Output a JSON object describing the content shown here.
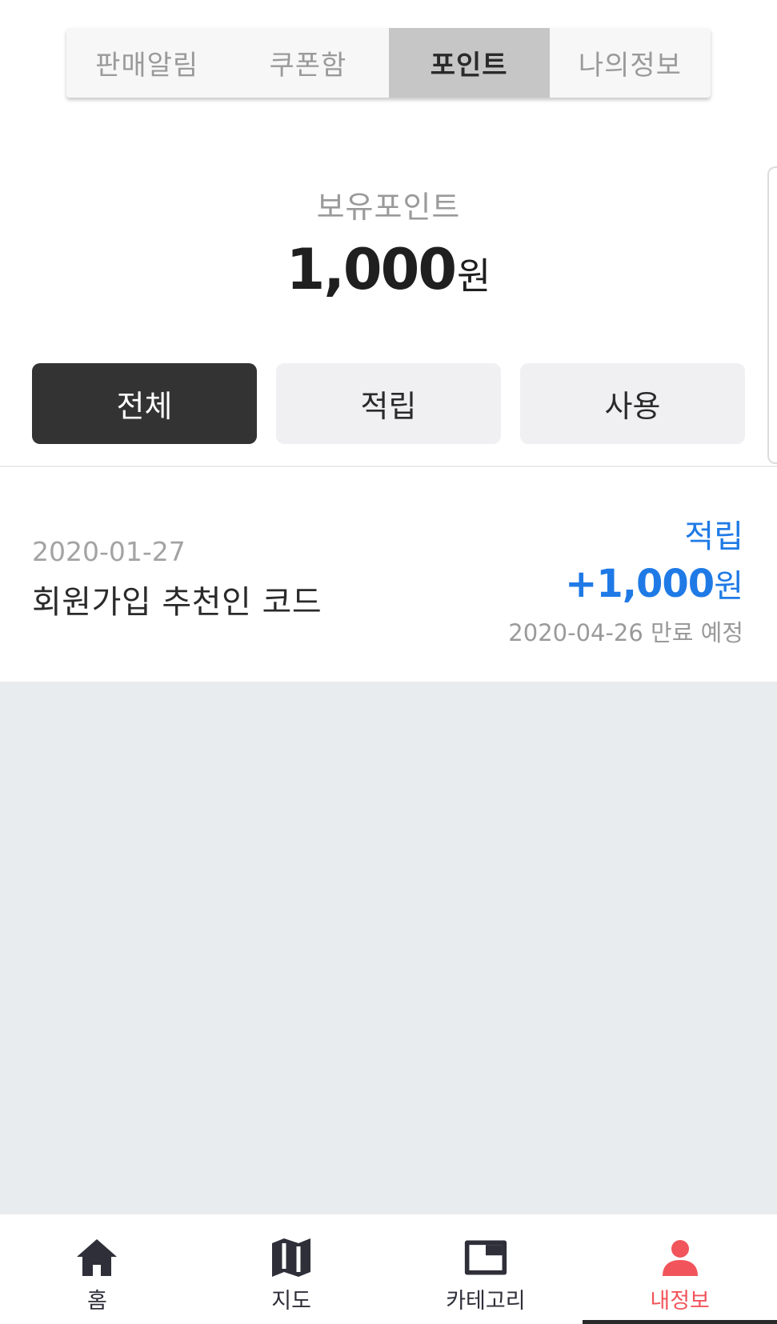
{
  "top_tabs": [
    {
      "label": "판매알림",
      "active": false
    },
    {
      "label": "쿠폰함",
      "active": false
    },
    {
      "label": "포인트",
      "active": true
    },
    {
      "label": "나의정보",
      "active": false
    }
  ],
  "balance": {
    "label": "보유포인트",
    "amount": "1,000",
    "unit": "원"
  },
  "filters": [
    {
      "label": "전체",
      "active": true
    },
    {
      "label": "적립",
      "active": false
    },
    {
      "label": "사용",
      "active": false
    }
  ],
  "history": [
    {
      "date": "2020-01-27",
      "title": "회원가입 추천인 코드",
      "type": "적립",
      "amount": "+1,000",
      "unit": "원",
      "expiry": "2020-04-26 만료 예정"
    }
  ],
  "bottom_nav": [
    {
      "label": "홈",
      "icon": "home-icon",
      "active": false
    },
    {
      "label": "지도",
      "icon": "map-icon",
      "active": false
    },
    {
      "label": "카테고리",
      "icon": "category-icon",
      "active": false
    },
    {
      "label": "내정보",
      "icon": "user-icon",
      "active": true
    }
  ],
  "colors": {
    "accent_blue": "#1f7ae6",
    "active_nav": "#f2545b",
    "dark_button": "#333333",
    "nav_icon": "#2f2f3a"
  }
}
